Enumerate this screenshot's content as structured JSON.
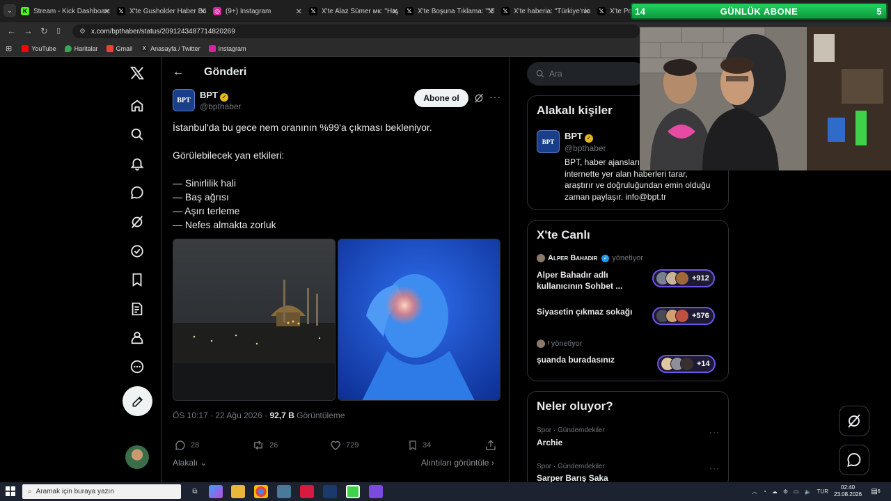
{
  "browser": {
    "tabs": [
      {
        "title": "Stream - Kick Dashboard",
        "fav_color": "#53fc18",
        "fav_glyph": "K"
      },
      {
        "title": "X'te Gusholder Haber Bül",
        "fav_color": "#000000",
        "fav_glyph": "𝕏"
      },
      {
        "title": "(9+) Instagram",
        "fav_color": "#d6249f",
        "fav_glyph": "◎"
      },
      {
        "title": "X'te Alaz Sümer мк: \"Hay",
        "fav_color": "#000000",
        "fav_glyph": "𝕏"
      },
      {
        "title": "X'te Boşuna Tıklama: \"\"Sa",
        "fav_color": "#000000",
        "fav_glyph": "𝕏"
      },
      {
        "title": "X'te haberia: \"Türkiye'nin",
        "fav_color": "#000000",
        "fav_glyph": "𝕏"
      },
      {
        "title": "X'te Pop",
        "fav_color": "#000000",
        "fav_glyph": "𝕏"
      }
    ],
    "url": "x.com/bpthaber/status/2091243487714820269",
    "bookmarks": [
      {
        "label": "YouTube",
        "color": "#ff0000"
      },
      {
        "label": "Haritalar",
        "color": "#34a853"
      },
      {
        "label": "Gmail",
        "color": "#ea4335"
      },
      {
        "label": "Anasayfa / Twitter",
        "color": "#222222"
      },
      {
        "label": "Instagram",
        "color": "#d6249f"
      }
    ]
  },
  "sub_widget": {
    "left_count": "14",
    "label": "GÜNLÜK ABONE",
    "right_count": "5"
  },
  "header": {
    "back": "←",
    "title": "Gönderi"
  },
  "post": {
    "avatar_text": "BPT",
    "author_name": "BPT",
    "author_handle": "@bpthaber",
    "follow_label": "Abone ol",
    "more": "···",
    "lines": [
      "İstanbul'da bu gece nem oranının %99'a çıkması bekleniyor.",
      "Görülebilecek yan etkileri:",
      "— Sinirlilik hali",
      "— Baş ağrısı",
      "— Aşırı terleme",
      "— Nefes almakta zorluk"
    ],
    "time": "ÖS 10:17 · 22 Ağu 2026 ·",
    "views": "92,7 B",
    "views_label": "Görüntüleme",
    "actions": {
      "replies": "28",
      "reposts": "26",
      "likes": "729",
      "bookmarks": "34"
    },
    "sort_label": "Alakalı",
    "quotes_label": "Alıntıları görüntüle"
  },
  "sidebar": {
    "search_placeholder": "Ara",
    "related": {
      "title": "Alakalı kişiler",
      "avatar_text": "BPT",
      "name": "BPT",
      "handle": "@bpthaber",
      "bio_lines": [
        "BPT, haber ajansları",
        "internette yer alan haberleri tarar,",
        "araştırır ve doğruluğundan emin olduğu",
        "zaman paylaşır. info@bpt.tr"
      ]
    },
    "live": {
      "title": "X'te Canlı",
      "spaces": [
        {
          "host": "Alper Bahadır",
          "host_suffix": "yönetiyor",
          "title_lines": [
            "Alper Bahadır adlı",
            "kullanıcının Sohbet ..."
          ],
          "count": "+912"
        },
        {
          "host": "",
          "host_suffix": "",
          "title_lines": [
            "Siyasetin çıkmaz sokağı"
          ],
          "count": "+576"
        },
        {
          "host": "ᵎ",
          "host_suffix": "yönetiyor",
          "title_lines": [
            "şuanda buradasınız"
          ],
          "count": "+14"
        }
      ]
    },
    "trends": {
      "title": "Neler oluyor?",
      "items": [
        {
          "category": "Spor · Gündemdekiler",
          "name": "Archie"
        },
        {
          "category": "Spor · Gündemdekiler",
          "name": "Sarper Barış Saka"
        }
      ]
    }
  },
  "taskbar": {
    "search_placeholder": "Aramak için buraya yazın",
    "lang": "TUR",
    "time": "02:40",
    "date": "23.08.2026",
    "notif_count": "6"
  },
  "colors": {
    "accent_blue": "#1d9bf0",
    "verified_gold": "#e2b719",
    "space_purple": "#6f54e8"
  }
}
